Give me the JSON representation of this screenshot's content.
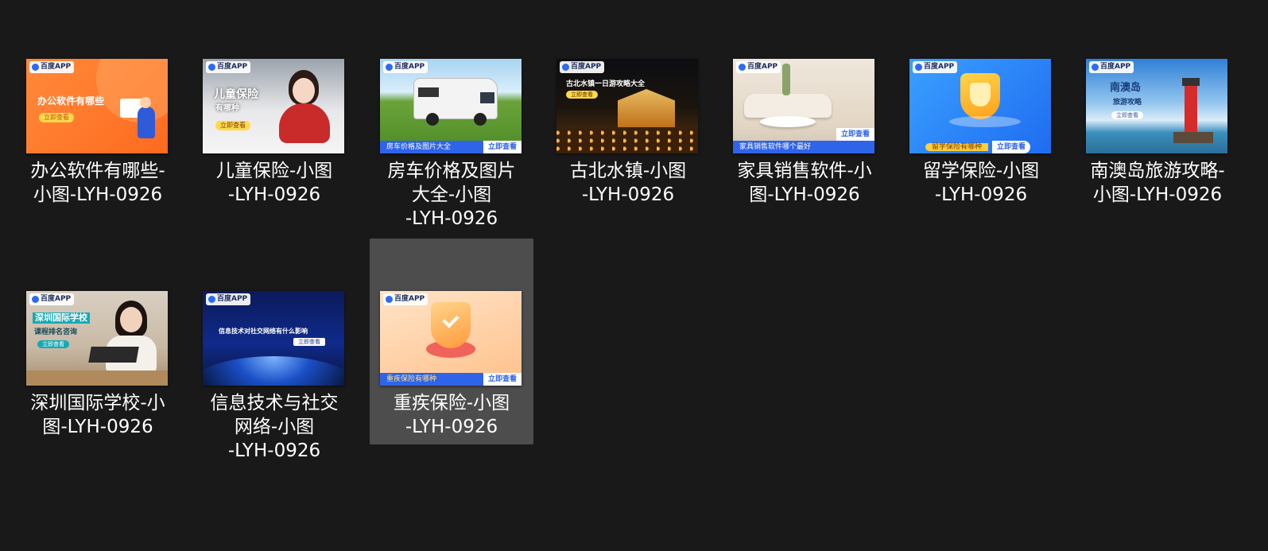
{
  "badge_text": "百度APP",
  "files": [
    {
      "name": "办公软件有哪些-\n小图-LYH-0926",
      "thumb": {
        "title": "办公软件有哪些",
        "cta": "立即查看"
      }
    },
    {
      "name": "儿童保险-小图\n-LYH-0926",
      "thumb": {
        "title": "儿童保险",
        "subtitle": "有哪种",
        "cta": "立即查看"
      }
    },
    {
      "name": "房车价格及图片\n大全-小图\n-LYH-0926",
      "thumb": {
        "strip": "房车价格及图片大全",
        "cta": "立即查看"
      }
    },
    {
      "name": "古北水镇-小图\n-LYH-0926",
      "thumb": {
        "title": "古北水镇一日游攻略大全",
        "cta": "立即查看"
      }
    },
    {
      "name": "家具销售软件-小\n图-LYH-0926",
      "thumb": {
        "strip": "家具销售软件哪个最好",
        "cta": "立即查看"
      }
    },
    {
      "name": "留学保险-小图\n-LYH-0926",
      "thumb": {
        "strip": "留学保险有哪种",
        "cta": "立即查看"
      }
    },
    {
      "name": "南澳岛旅游攻略-\n小图-LYH-0926",
      "thumb": {
        "title": "南澳岛",
        "subtitle": "旅游攻略",
        "cta": "立即查看"
      }
    },
    {
      "name": "深圳国际学校-小\n图-LYH-0926",
      "thumb": {
        "title": "深圳国际学校",
        "subtitle": "课程排名咨询",
        "cta": "立即查看"
      }
    },
    {
      "name": "信息技术与社交\n网络-小图\n-LYH-0926",
      "thumb": {
        "title": "信息技术对社交网络有什么影响",
        "cta": "立即查看"
      }
    },
    {
      "name": "重疾保险-小图\n-LYH-0926",
      "thumb": {
        "strip": "重疾保险有哪种",
        "cta": "立即查看"
      }
    }
  ]
}
